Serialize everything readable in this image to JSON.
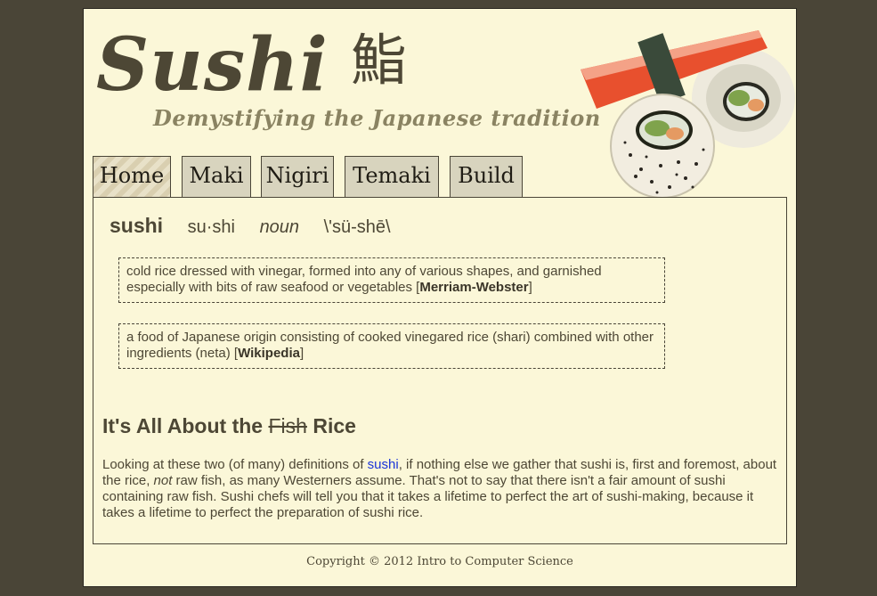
{
  "header": {
    "logo_text": "Sushi",
    "logo_kanji": "鮨",
    "tagline": "Demystifying the Japanese tradition"
  },
  "nav": {
    "tabs": [
      {
        "label": "Home",
        "active": true
      },
      {
        "label": "Maki",
        "active": false
      },
      {
        "label": "Nigiri",
        "active": false
      },
      {
        "label": "Temaki",
        "active": false
      },
      {
        "label": "Build",
        "active": false
      }
    ]
  },
  "definition": {
    "word": "sushi",
    "syllables": "su·shi",
    "part_of_speech": "noun",
    "pronunciation": "\\'sü-shē\\",
    "entries": [
      {
        "text": "cold rice dressed with vinegar, formed into any of various shapes, and garnished especially with bits of raw seafood or vegetables [",
        "source": "Merriam-Webster",
        "close": "]"
      },
      {
        "text": "a food of Japanese origin consisting of cooked vinegared rice (shari) combined with other ingredients (neta) [",
        "source": "Wikipedia",
        "close": "]"
      }
    ]
  },
  "article": {
    "heading_start": "It's All About the ",
    "heading_struck": "Fish",
    "heading_end": " Rice",
    "para_part1": "Looking at these two (of many) definitions of ",
    "link_text": "sushi",
    "para_part2": ", if nothing else we gather that sushi is, first and foremost, about the rice, ",
    "para_em": "not",
    "para_part3": " raw fish, as many Westerners assume. That's not to say that there isn't a fair amount of sushi containing raw fish. Sushi chefs will tell you that it takes a lifetime to perfect the art of sushi-making, because it takes a lifetime to perfect the preparation of sushi rice."
  },
  "footer": {
    "copyright": "Copyright © 2012 Intro to Computer Science"
  },
  "colors": {
    "page_background": "#4a4537",
    "content_background": "#fbf7d8",
    "text": "#4d4735",
    "link": "#1a35d8",
    "tab_background": "#d8d4be"
  }
}
